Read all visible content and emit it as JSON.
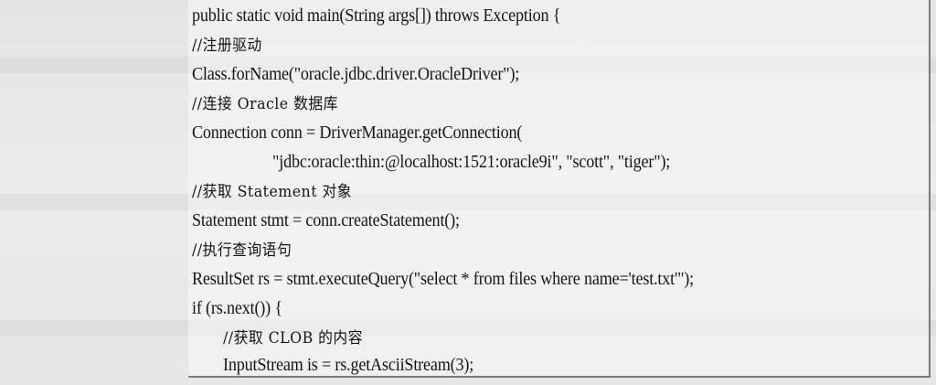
{
  "code": {
    "lines": [
      {
        "text": "public static void main(String args[]) throws Exception {",
        "type": "code"
      },
      {
        "text": "//注册驱动",
        "type": "comment"
      },
      {
        "text": "Class.forName(\"oracle.jdbc.driver.OracleDriver\");",
        "type": "code"
      },
      {
        "text": "//连接 Oracle 数据库",
        "type": "comment"
      },
      {
        "text": "Connection conn = DriverManager.getConnection(",
        "type": "code"
      },
      {
        "text": "\"jdbc:oracle:thin:@localhost:1521:oracle9i\", \"scott\", \"tiger\");",
        "type": "code"
      },
      {
        "text": "//获取 Statement 对象",
        "type": "comment"
      },
      {
        "text": "Statement stmt = conn.createStatement();",
        "type": "code"
      },
      {
        "text": "//执行查询语句",
        "type": "comment"
      },
      {
        "text": "ResultSet rs = stmt.executeQuery(\"select * from files where name='test.txt'\");",
        "type": "code"
      },
      {
        "text": "if (rs.next()) {",
        "type": "code"
      },
      {
        "text": "//获取 CLOB 的内容",
        "type": "comment"
      },
      {
        "text": "InputStream is = rs.getAsciiStream(3);",
        "type": "code"
      }
    ]
  }
}
